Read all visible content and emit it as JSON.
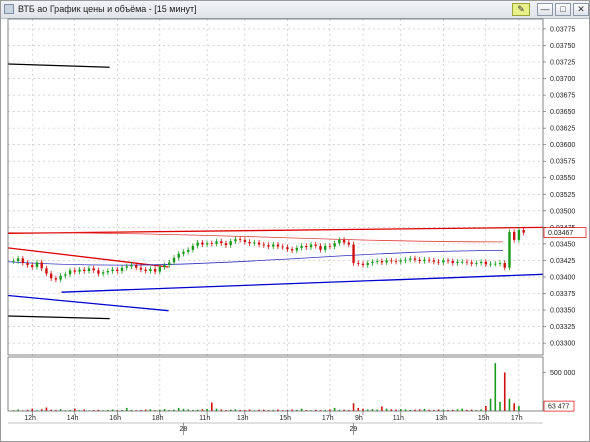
{
  "window": {
    "title": "ВТБ ao График цены и объёма - [15 минут]",
    "buttons": {
      "pin": "✎",
      "minimize": "—",
      "maximize": "□",
      "close": "✕"
    }
  },
  "chart_data": [
    {
      "type": "line",
      "title": "",
      "ylabels": [
        "0.03775",
        "0.03750",
        "0.03725",
        "0.03700",
        "0.03675",
        "0.03650",
        "0.03625",
        "0.03600",
        "0.03575",
        "0.03550",
        "0.03525",
        "0.03500",
        "0.03475",
        "0.03450",
        "0.03425",
        "0.03400",
        "0.03375",
        "0.03350",
        "0.03325",
        "0.03300"
      ],
      "ylim": [
        0.03282,
        0.0379
      ],
      "current_price_label": "0.03467",
      "current_price": 0.03467,
      "x_ticks": [
        "12h",
        "14h",
        "16h",
        "18h",
        "11h",
        "13h",
        "15h",
        "17h",
        "9h",
        "11h",
        "13h",
        "15h",
        "17h"
      ],
      "date_labels": [
        "28",
        "29"
      ],
      "grid": true,
      "series": [
        {
          "values": [
            0.03424,
            0.03428,
            0.03421,
            0.03418,
            0.03415,
            0.03422,
            0.03413,
            0.03405,
            0.03398,
            0.03396,
            0.03402,
            0.03404,
            0.0341,
            0.03408,
            0.03411,
            0.03409,
            0.03413,
            0.0341,
            0.03405,
            0.03407,
            0.03409,
            0.03411,
            0.03409,
            0.03414,
            0.03416,
            0.03418,
            0.03414,
            0.03411,
            0.03409,
            0.03412,
            0.03408,
            0.03415,
            0.03418,
            0.03422,
            0.03429,
            0.03435,
            0.03438,
            0.03441,
            0.03447,
            0.03452,
            0.03449,
            0.03451,
            0.0345,
            0.03454,
            0.03451,
            0.03448,
            0.03454,
            0.03457,
            0.03456,
            0.03453,
            0.03451,
            0.03452,
            0.03449,
            0.03448,
            0.03446,
            0.03449,
            0.03446,
            0.03445,
            0.03442,
            0.0344,
            0.03444,
            0.03447,
            0.03445,
            0.03449,
            0.03447,
            0.03441,
            0.03447,
            0.03446,
            0.03451,
            0.03456,
            0.03452,
            0.03449,
            0.03421,
            0.0342,
            0.03418,
            0.03421,
            0.03423,
            0.03424,
            0.03422,
            0.03425,
            0.03424,
            0.03423,
            0.03425,
            0.03426,
            0.03428,
            0.03426,
            0.03424,
            0.03426,
            0.03425,
            0.03423,
            0.03422,
            0.03425,
            0.03424,
            0.03421,
            0.03423,
            0.03423,
            0.03422,
            0.0342,
            0.03421,
            0.03423,
            0.03419,
            0.0342,
            0.0342,
            0.03421,
            0.03414,
            0.03468,
            0.03456,
            0.03471,
            0.03467
          ]
        },
        {
          "name": "upper-band",
          "values": [
            0.03467,
            0.03453
          ]
        },
        {
          "name": "lower-band",
          "values": [
            0.03423,
            0.0344
          ]
        }
      ],
      "trendlines": [
        {
          "color": "#e00000",
          "from": [
            0.0,
            0.03466
          ],
          "to": [
            1.0,
            0.03475
          ]
        },
        {
          "color": "#e00000",
          "from": [
            0.0,
            0.03444
          ],
          "to": [
            0.3,
            0.03415
          ]
        },
        {
          "color": "#0000d0",
          "from": [
            0.1,
            0.03377
          ],
          "to": [
            1.0,
            0.03404
          ]
        },
        {
          "color": "#0000d0",
          "from": [
            0.0,
            0.03372
          ],
          "to": [
            0.3,
            0.03349
          ]
        },
        {
          "color": "#000000",
          "from": [
            0.0,
            0.03722
          ],
          "to": [
            0.19,
            0.03717
          ]
        },
        {
          "color": "#000000",
          "from": [
            0.0,
            0.03341
          ],
          "to": [
            0.19,
            0.03337
          ]
        }
      ]
    },
    {
      "type": "bar",
      "ylabels": [
        "500 000"
      ],
      "volume_label": "63 477",
      "ylim": [
        0,
        700000
      ],
      "values": [
        12000,
        20000,
        8000,
        15000,
        30000,
        10000,
        22000,
        45000,
        18000,
        12000,
        25000,
        9000,
        14000,
        30000,
        11000,
        20000,
        8000,
        12000,
        16000,
        9000,
        14000,
        20000,
        10000,
        12000,
        40000,
        15000,
        10000,
        12000,
        18000,
        22000,
        10000,
        15000,
        25000,
        12000,
        18000,
        40000,
        28000,
        20000,
        14000,
        18000,
        22000,
        26000,
        110000,
        30000,
        20000,
        12000,
        18000,
        22000,
        14000,
        12000,
        20000,
        10000,
        16000,
        18000,
        12000,
        14000,
        20000,
        10000,
        12000,
        18000,
        14000,
        30000,
        12000,
        10000,
        16000,
        12000,
        14000,
        20000,
        40000,
        14000,
        18000,
        12000,
        100000,
        40000,
        30000,
        20000,
        25000,
        18000,
        60000,
        30000,
        22000,
        18000,
        25000,
        20000,
        14000,
        18000,
        22000,
        28000,
        16000,
        12000,
        20000,
        18000,
        14000,
        16000,
        22000,
        30000,
        15000,
        18000,
        12000,
        20000,
        65000,
        160000,
        620000,
        120000,
        500000,
        160000,
        100000,
        63477
      ]
    }
  ]
}
